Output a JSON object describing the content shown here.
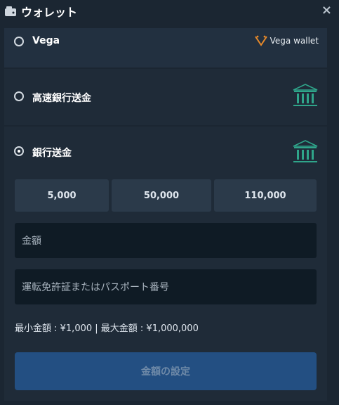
{
  "header": {
    "title": "ウォレット",
    "close_label": "×"
  },
  "options": [
    {
      "label": "Vega",
      "selected": false,
      "logo_text": "Vega wallet"
    },
    {
      "label": "高速銀行送金",
      "selected": false
    },
    {
      "label": "銀行送金",
      "selected": true
    }
  ],
  "amounts": [
    "5,000",
    "50,000",
    "110,000"
  ],
  "fields": {
    "amount_placeholder": "金額",
    "id_placeholder": "運転免許証またはパスポート番号"
  },
  "limits_text": "最小金額 : ¥1,000 | 最大金額 : ¥1,000,000",
  "submit_label": "金額の設定",
  "colors": {
    "background": "#1b2632",
    "panel": "#1f2b38",
    "button": "#2b3a4a",
    "field": "#0f1b25",
    "submit": "#234f82",
    "accent_green": "#2fa58a",
    "vega_orange": "#e88a2a"
  },
  "icons": [
    "wallet-icon",
    "close-icon",
    "vega-logo-icon",
    "bank-icon"
  ]
}
